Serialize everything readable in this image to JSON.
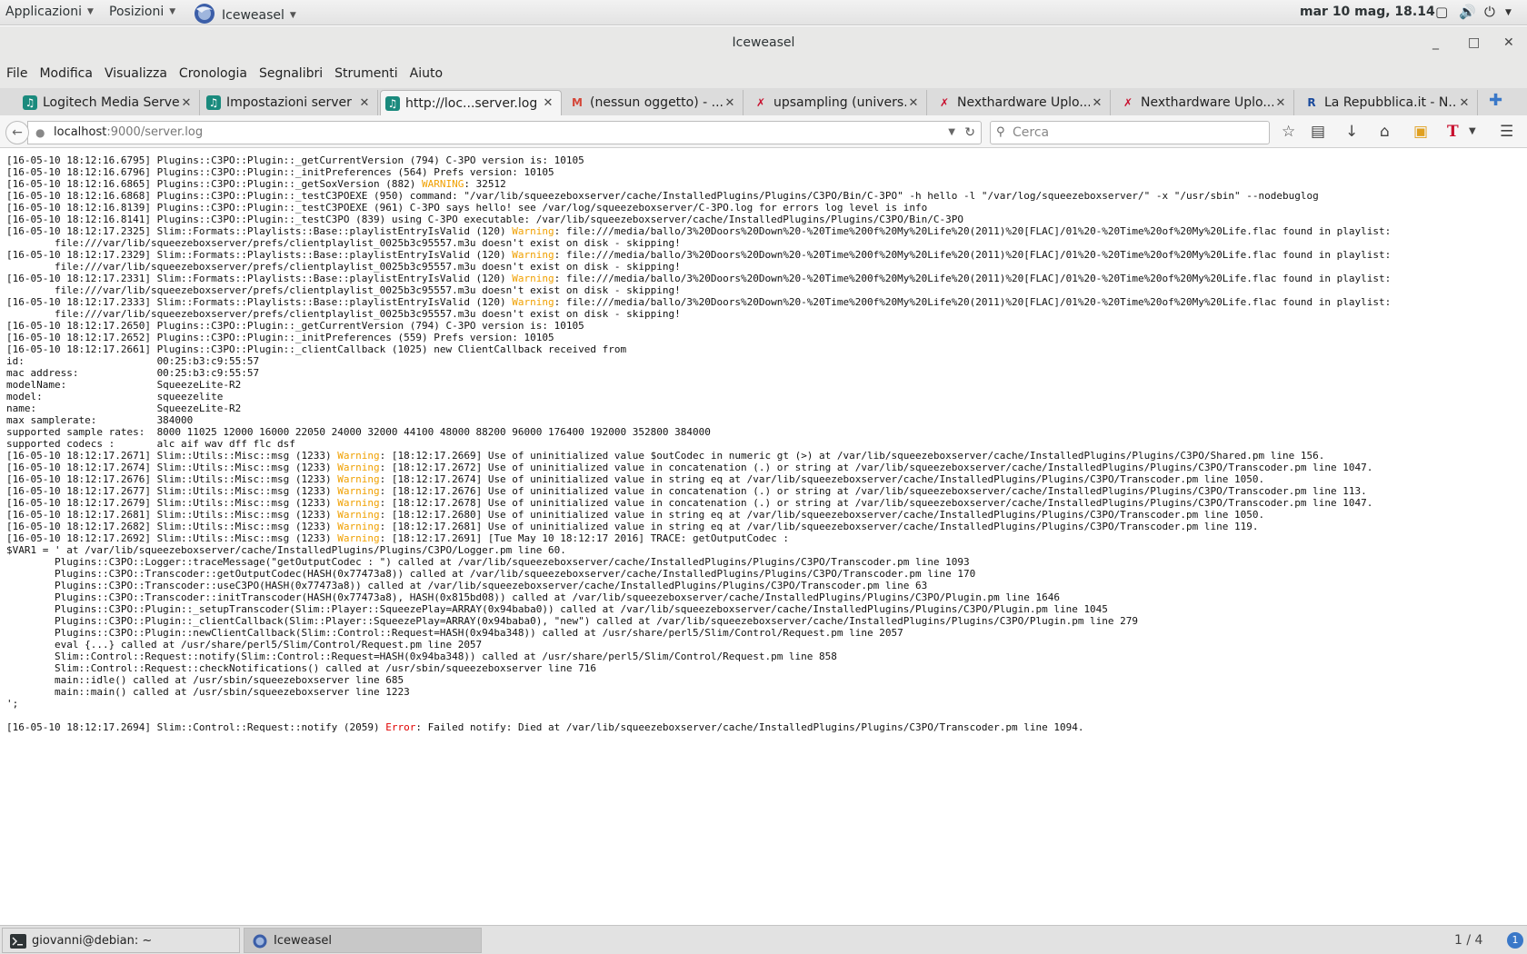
{
  "topbar": {
    "applications": "Applicazioni",
    "places": "Posizioni",
    "app_menu": "Iceweasel",
    "clock": "mar 10 mag, 18.14"
  },
  "window": {
    "title": "Iceweasel"
  },
  "menubar": [
    "File",
    "Modifica",
    "Visualizza",
    "Cronologia",
    "Segnalibri",
    "Strumenti",
    "Aiuto"
  ],
  "tabs": [
    {
      "label": "Logitech Media Server",
      "favicon": "lms-icon"
    },
    {
      "label": "Impostazioni server",
      "favicon": "lms-icon"
    },
    {
      "label": "http://loc...server.log",
      "favicon": "lms-icon",
      "active": true
    },
    {
      "label": "(nessun oggetto) - ...",
      "favicon": "gmail-icon"
    },
    {
      "label": "upsampling (univers...",
      "favicon": "nexthardware-icon"
    },
    {
      "label": "Nexthardware Uplo...",
      "favicon": "nexthardware-icon"
    },
    {
      "label": "Nexthardware Uplo...",
      "favicon": "nexthardware-icon"
    },
    {
      "label": "La Repubblica.it - N...",
      "favicon": "repubblica-icon"
    }
  ],
  "navbar": {
    "url_host": "localhost",
    "url_path": ":9000/server.log",
    "search_placeholder": "Cerca"
  },
  "log": [
    [
      {
        "t": "[16-05-10 18:12:16.6795] Plugins::C3PO::Plugin::_getCurrentVersion (794) C-3PO version is: 10105"
      }
    ],
    [
      {
        "t": "[16-05-10 18:12:16.6796] Plugins::C3PO::Plugin::_initPreferences (564) Prefs version: 10105"
      }
    ],
    [
      {
        "t": "[16-05-10 18:12:16.6865] Plugins::C3PO::Plugin::_getSoxVersion (882) "
      },
      {
        "t": "WARNING",
        "c": "warn"
      },
      {
        "t": ": 32512"
      }
    ],
    [
      {
        "t": "[16-05-10 18:12:16.6868] Plugins::C3PO::Plugin::_testC3POEXE (950) command: \"/var/lib/squeezeboxserver/cache/InstalledPlugins/Plugins/C3PO/Bin/C-3PO\" -h hello -l \"/var/log/squeezeboxserver/\" -x \"/usr/sbin\" --nodebuglog"
      }
    ],
    [
      {
        "t": "[16-05-10 18:12:16.8139] Plugins::C3PO::Plugin::_testC3POEXE (961) C-3PO says hello! see /var/log/squeezeboxserver/C-3PO.log for errors log level is info"
      }
    ],
    [
      {
        "t": "[16-05-10 18:12:16.8141] Plugins::C3PO::Plugin::_testC3PO (839) using C-3PO executable: /var/lib/squeezeboxserver/cache/InstalledPlugins/Plugins/C3PO/Bin/C-3PO"
      }
    ],
    [
      {
        "t": "[16-05-10 18:12:17.2325] Slim::Formats::Playlists::Base::playlistEntryIsValid (120) "
      },
      {
        "t": "Warning",
        "c": "warn"
      },
      {
        "t": ": file:///media/ballo/3%20Doors%20Down%20-%20Time%200f%20My%20Life%20(2011)%20[FLAC]/01%20-%20Time%20of%20My%20Life.flac found in playlist:"
      }
    ],
    [
      {
        "t": "        file:///var/lib/squeezeboxserver/prefs/clientplaylist_0025b3c95557.m3u doesn't exist on disk - skipping!"
      }
    ],
    [
      {
        "t": "[16-05-10 18:12:17.2329] Slim::Formats::Playlists::Base::playlistEntryIsValid (120) "
      },
      {
        "t": "Warning",
        "c": "warn"
      },
      {
        "t": ": file:///media/ballo/3%20Doors%20Down%20-%20Time%200f%20My%20Life%20(2011)%20[FLAC]/01%20-%20Time%20of%20My%20Life.flac found in playlist:"
      }
    ],
    [
      {
        "t": "        file:///var/lib/squeezeboxserver/prefs/clientplaylist_0025b3c95557.m3u doesn't exist on disk - skipping!"
      }
    ],
    [
      {
        "t": "[16-05-10 18:12:17.2331] Slim::Formats::Playlists::Base::playlistEntryIsValid (120) "
      },
      {
        "t": "Warning",
        "c": "warn"
      },
      {
        "t": ": file:///media/ballo/3%20Doors%20Down%20-%20Time%200f%20My%20Life%20(2011)%20[FLAC]/01%20-%20Time%20of%20My%20Life.flac found in playlist:"
      }
    ],
    [
      {
        "t": "        file:///var/lib/squeezeboxserver/prefs/clientplaylist_0025b3c95557.m3u doesn't exist on disk - skipping!"
      }
    ],
    [
      {
        "t": "[16-05-10 18:12:17.2333] Slim::Formats::Playlists::Base::playlistEntryIsValid (120) "
      },
      {
        "t": "Warning",
        "c": "warn"
      },
      {
        "t": ": file:///media/ballo/3%20Doors%20Down%20-%20Time%200f%20My%20Life%20(2011)%20[FLAC]/01%20-%20Time%20of%20My%20Life.flac found in playlist:"
      }
    ],
    [
      {
        "t": "        file:///var/lib/squeezeboxserver/prefs/clientplaylist_0025b3c95557.m3u doesn't exist on disk - skipping!"
      }
    ],
    [
      {
        "t": "[16-05-10 18:12:17.2650] Plugins::C3PO::Plugin::_getCurrentVersion (794) C-3PO version is: 10105"
      }
    ],
    [
      {
        "t": "[16-05-10 18:12:17.2652] Plugins::C3PO::Plugin::_initPreferences (559) Prefs version: 10105"
      }
    ],
    [
      {
        "t": "[16-05-10 18:12:17.2661] Plugins::C3PO::Plugin::_clientCallback (1025) new ClientCallback received from"
      }
    ],
    [
      {
        "t": "id:                      00:25:b3:c9:55:57"
      }
    ],
    [
      {
        "t": "mac address:             00:25:b3:c9:55:57"
      }
    ],
    [
      {
        "t": "modelName:               SqueezeLite-R2"
      }
    ],
    [
      {
        "t": "model:                   squeezelite"
      }
    ],
    [
      {
        "t": "name:                    SqueezeLite-R2"
      }
    ],
    [
      {
        "t": "max samplerate:          384000"
      }
    ],
    [
      {
        "t": "supported sample rates:  8000 11025 12000 16000 22050 24000 32000 44100 48000 88200 96000 176400 192000 352800 384000"
      }
    ],
    [
      {
        "t": "supported codecs :       alc aif wav dff flc dsf"
      }
    ],
    [
      {
        "t": "[16-05-10 18:12:17.2671] Slim::Utils::Misc::msg (1233) "
      },
      {
        "t": "Warning",
        "c": "warn"
      },
      {
        "t": ": [18:12:17.2669] Use of uninitialized value $outCodec in numeric gt (>) at /var/lib/squeezeboxserver/cache/InstalledPlugins/Plugins/C3PO/Shared.pm line 156."
      }
    ],
    [
      {
        "t": "[16-05-10 18:12:17.2674] Slim::Utils::Misc::msg (1233) "
      },
      {
        "t": "Warning",
        "c": "warn"
      },
      {
        "t": ": [18:12:17.2672] Use of uninitialized value in concatenation (.) or string at /var/lib/squeezeboxserver/cache/InstalledPlugins/Plugins/C3PO/Transcoder.pm line 1047."
      }
    ],
    [
      {
        "t": "[16-05-10 18:12:17.2676] Slim::Utils::Misc::msg (1233) "
      },
      {
        "t": "Warning",
        "c": "warn"
      },
      {
        "t": ": [18:12:17.2674] Use of uninitialized value in string eq at /var/lib/squeezeboxserver/cache/InstalledPlugins/Plugins/C3PO/Transcoder.pm line 1050."
      }
    ],
    [
      {
        "t": "[16-05-10 18:12:17.2677] Slim::Utils::Misc::msg (1233) "
      },
      {
        "t": "Warning",
        "c": "warn"
      },
      {
        "t": ": [18:12:17.2676] Use of uninitialized value in concatenation (.) or string at /var/lib/squeezeboxserver/cache/InstalledPlugins/Plugins/C3PO/Transcoder.pm line 113."
      }
    ],
    [
      {
        "t": "[16-05-10 18:12:17.2679] Slim::Utils::Misc::msg (1233) "
      },
      {
        "t": "Warning",
        "c": "warn"
      },
      {
        "t": ": [18:12:17.2678] Use of uninitialized value in concatenation (.) or string at /var/lib/squeezeboxserver/cache/InstalledPlugins/Plugins/C3PO/Transcoder.pm line 1047."
      }
    ],
    [
      {
        "t": "[16-05-10 18:12:17.2681] Slim::Utils::Misc::msg (1233) "
      },
      {
        "t": "Warning",
        "c": "warn"
      },
      {
        "t": ": [18:12:17.2680] Use of uninitialized value in string eq at /var/lib/squeezeboxserver/cache/InstalledPlugins/Plugins/C3PO/Transcoder.pm line 1050."
      }
    ],
    [
      {
        "t": "[16-05-10 18:12:17.2682] Slim::Utils::Misc::msg (1233) "
      },
      {
        "t": "Warning",
        "c": "warn"
      },
      {
        "t": ": [18:12:17.2681] Use of uninitialized value in string eq at /var/lib/squeezeboxserver/cache/InstalledPlugins/Plugins/C3PO/Transcoder.pm line 119."
      }
    ],
    [
      {
        "t": "[16-05-10 18:12:17.2692] Slim::Utils::Misc::msg (1233) "
      },
      {
        "t": "Warning",
        "c": "warn"
      },
      {
        "t": ": [18:12:17.2691] [Tue May 10 18:12:17 2016] TRACE: getOutputCodec :"
      }
    ],
    [
      {
        "t": "$VAR1 = ' at /var/lib/squeezeboxserver/cache/InstalledPlugins/Plugins/C3PO/Logger.pm line 60."
      }
    ],
    [
      {
        "t": "        Plugins::C3PO::Logger::traceMessage(\"getOutputCodec : \") called at /var/lib/squeezeboxserver/cache/InstalledPlugins/Plugins/C3PO/Transcoder.pm line 1093"
      }
    ],
    [
      {
        "t": "        Plugins::C3PO::Transcoder::getOutputCodec(HASH(0x77473a8)) called at /var/lib/squeezeboxserver/cache/InstalledPlugins/Plugins/C3PO/Transcoder.pm line 170"
      }
    ],
    [
      {
        "t": "        Plugins::C3PO::Transcoder::useC3PO(HASH(0x77473a8)) called at /var/lib/squeezeboxserver/cache/InstalledPlugins/Plugins/C3PO/Transcoder.pm line 63"
      }
    ],
    [
      {
        "t": "        Plugins::C3PO::Transcoder::initTranscoder(HASH(0x77473a8), HASH(0x815bd08)) called at /var/lib/squeezeboxserver/cache/InstalledPlugins/Plugins/C3PO/Plugin.pm line 1646"
      }
    ],
    [
      {
        "t": "        Plugins::C3PO::Plugin::_setupTranscoder(Slim::Player::SqueezePlay=ARRAY(0x94baba0)) called at /var/lib/squeezeboxserver/cache/InstalledPlugins/Plugins/C3PO/Plugin.pm line 1045"
      }
    ],
    [
      {
        "t": "        Plugins::C3PO::Plugin::_clientCallback(Slim::Player::SqueezePlay=ARRAY(0x94baba0), \"new\") called at /var/lib/squeezeboxserver/cache/InstalledPlugins/Plugins/C3PO/Plugin.pm line 279"
      }
    ],
    [
      {
        "t": "        Plugins::C3PO::Plugin::newClientCallback(Slim::Control::Request=HASH(0x94ba348)) called at /usr/share/perl5/Slim/Control/Request.pm line 2057"
      }
    ],
    [
      {
        "t": "        eval {...} called at /usr/share/perl5/Slim/Control/Request.pm line 2057"
      }
    ],
    [
      {
        "t": "        Slim::Control::Request::notify(Slim::Control::Request=HASH(0x94ba348)) called at /usr/share/perl5/Slim/Control/Request.pm line 858"
      }
    ],
    [
      {
        "t": "        Slim::Control::Request::checkNotifications() called at /usr/sbin/squeezeboxserver line 716"
      }
    ],
    [
      {
        "t": "        main::idle() called at /usr/sbin/squeezeboxserver line 685"
      }
    ],
    [
      {
        "t": "        main::main() called at /usr/sbin/squeezeboxserver line 1223"
      }
    ],
    [
      {
        "t": "';"
      }
    ],
    [
      {
        "t": ""
      }
    ],
    [
      {
        "t": "[16-05-10 18:12:17.2694] Slim::Control::Request::notify (2059) "
      },
      {
        "t": "Error",
        "c": "err"
      },
      {
        "t": ": Failed notify: Died at /var/lib/squeezeboxserver/cache/InstalledPlugins/Plugins/C3PO/Transcoder.pm line 1094."
      }
    ]
  ],
  "taskbar": {
    "tasks": [
      {
        "label": "giovanni@debian: ~",
        "icon": "terminal-icon"
      },
      {
        "label": "Iceweasel",
        "icon": "iceweasel-icon",
        "active": true
      }
    ],
    "workspace": "1 / 4",
    "workspace_badge": "1"
  }
}
